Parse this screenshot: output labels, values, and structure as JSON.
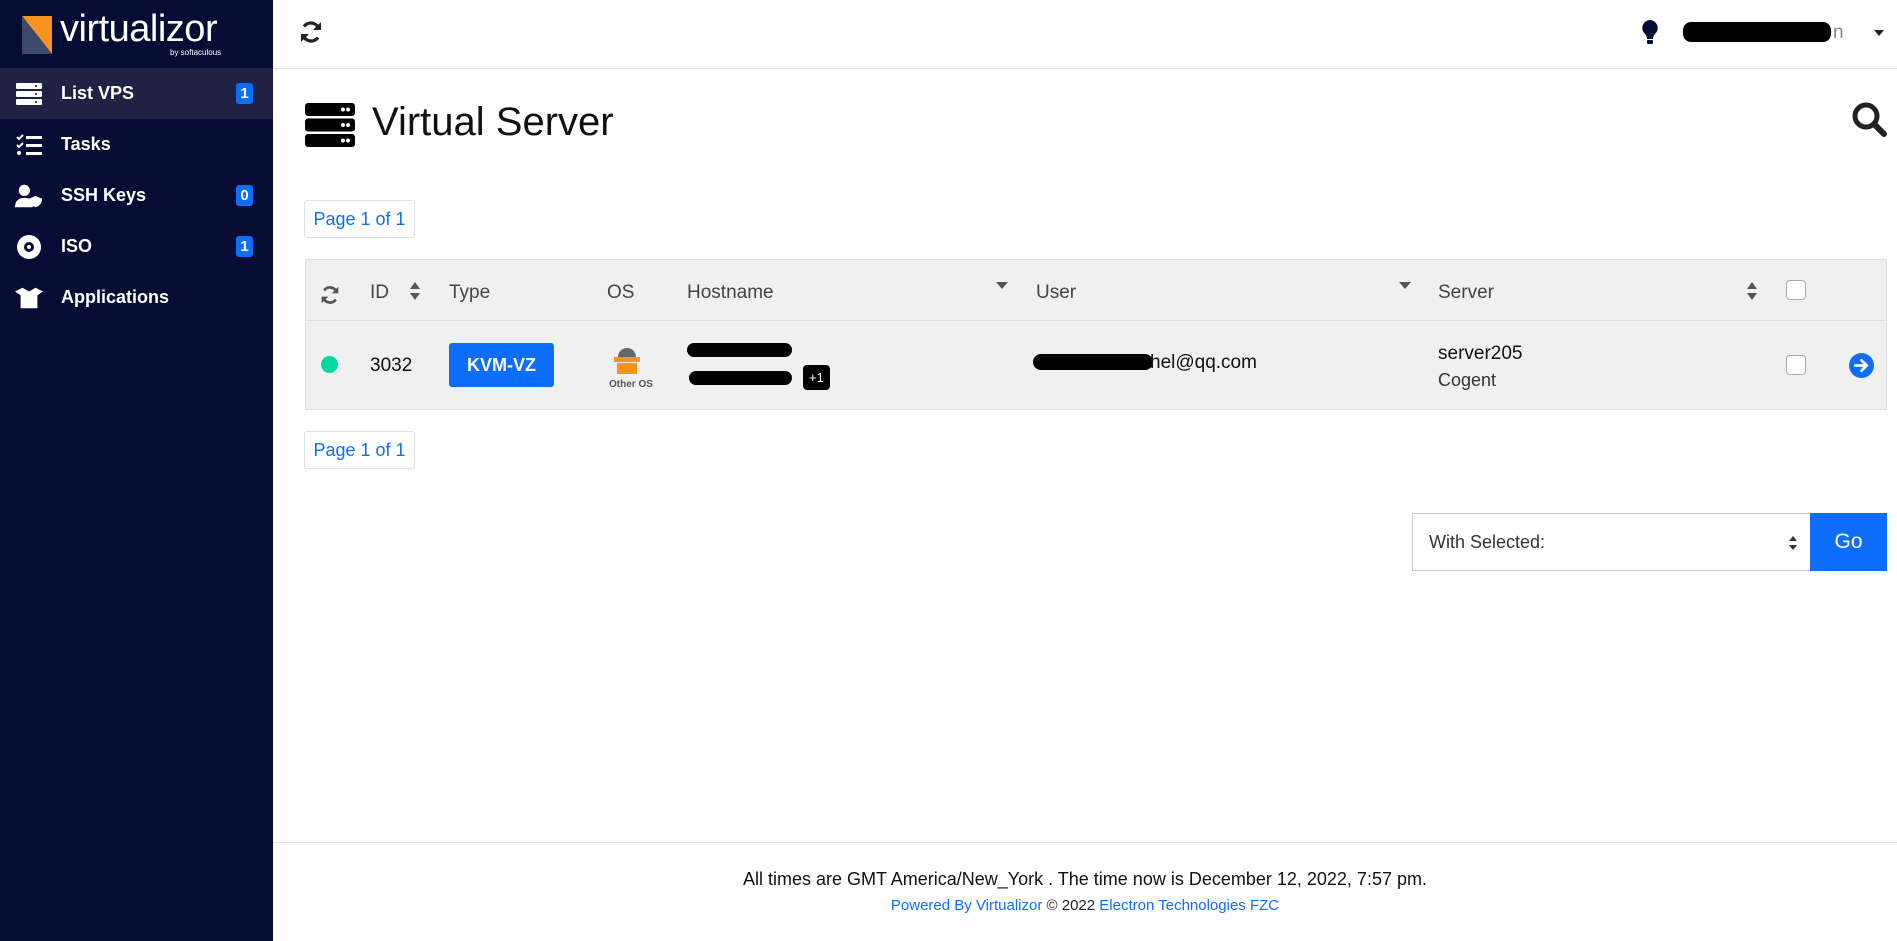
{
  "brand": {
    "name": "virtualizor",
    "sub": "by softaculous"
  },
  "sidebar": {
    "items": [
      {
        "label": "List VPS",
        "badge": "1",
        "icon": "server-icon",
        "active": true
      },
      {
        "label": "Tasks",
        "badge": null,
        "icon": "tasks-icon"
      },
      {
        "label": "SSH Keys",
        "badge": "0",
        "icon": "user-shield-icon"
      },
      {
        "label": "ISO",
        "badge": "1",
        "icon": "disc-icon"
      },
      {
        "label": "Applications",
        "badge": null,
        "icon": "box-open-icon"
      }
    ]
  },
  "header": {
    "user_suffix": "n"
  },
  "page": {
    "title": "Virtual Server",
    "pagination_top": "Page 1 of 1",
    "pagination_bottom": "Page 1 of 1"
  },
  "table": {
    "columns": {
      "id": "ID",
      "type": "Type",
      "os": "OS",
      "hostname": "Hostname",
      "user": "User",
      "server": "Server"
    },
    "rows": [
      {
        "status": "online",
        "status_color": "#06d6a0",
        "id": "3032",
        "type": "KVM-VZ",
        "os": "Other OS",
        "extra_ips": "+1",
        "user_visible": "hel@qq.com",
        "server": "server205",
        "server_group": "Cogent"
      }
    ]
  },
  "actions": {
    "with_selected": "With Selected:",
    "go": "Go"
  },
  "footer": {
    "time_note": "All times are GMT America/New_York . The time now is December 12, 2022, 7:57 pm.",
    "powered": "Powered By Virtualizor",
    "copyright": " © 2022 ",
    "company": "Electron Technologies FZC"
  },
  "colors": {
    "sidebar": "#070c34",
    "accent": "#0d6efd"
  }
}
